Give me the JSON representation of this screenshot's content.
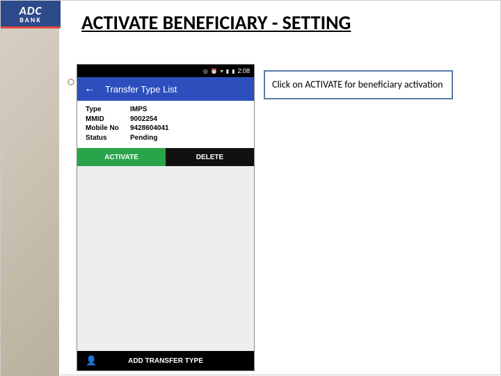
{
  "logo": {
    "top": "ADC",
    "bottom": "BANK"
  },
  "title": "ACTIVATE BENEFICIARY - SETTING",
  "callout": "Click on ACTIVATE for beneficiary activation",
  "phone": {
    "status_time": "2:08",
    "app_bar_title": "Transfer Type List",
    "info": {
      "type": {
        "label": "Type",
        "value": "IMPS"
      },
      "mmid": {
        "label": "MMID",
        "value": "9002254"
      },
      "mobile": {
        "label": "Mobile No",
        "value": "9428604041"
      },
      "status": {
        "label": "Status",
        "value": "Pending"
      }
    },
    "buttons": {
      "activate": "ACTIVATE",
      "delete": "DELETE"
    },
    "add_transfer_type": "ADD TRANSFER TYPE"
  }
}
